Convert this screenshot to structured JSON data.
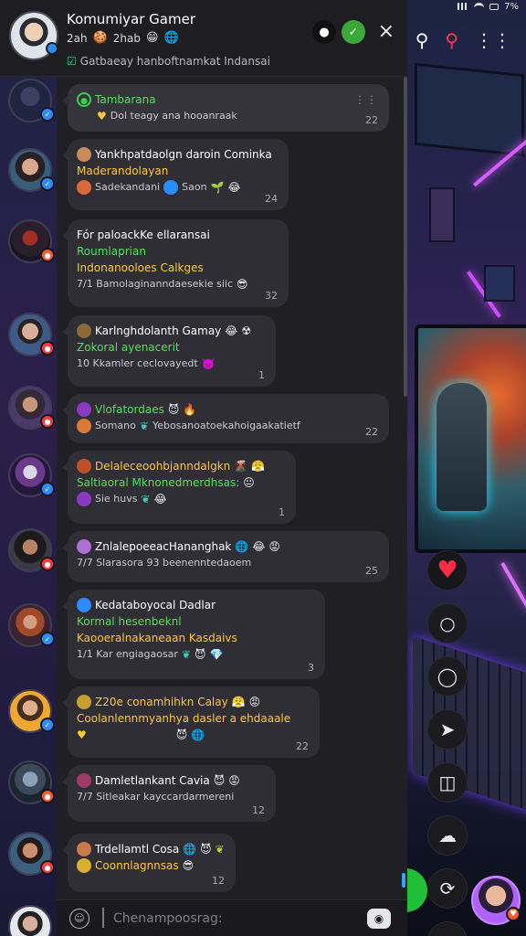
{
  "status_bar": {
    "battery": "7%"
  },
  "top_icons": [
    "search-icon",
    "search-icon",
    "more-icon"
  ],
  "header": {
    "title": "Komumiyar Gamer",
    "meta_a": "2ah",
    "meta_b": "2hab",
    "description": "Gatbaeay hanboftnamkat Indansai",
    "close": "×"
  },
  "pinned": {
    "title": "Tambarana",
    "subtitle": "Dol teagy ana hooanraak",
    "time": "22"
  },
  "messages": [
    {
      "name": "Yankhpatdaolgn daroin Cominka",
      "line1": "Maderandolayan",
      "line2": "Sadekandani",
      "line2b": "Saon",
      "time": "24"
    },
    {
      "name": "Fór paloackKe ellaransai",
      "line1": "Roumlaprian",
      "line2": "Indonanooloes Calkges",
      "line3": "7/1 Bamolaginanndaesekie siic",
      "time": "32"
    },
    {
      "name": "Karlnghdolanth Gamay",
      "line1": "Zokoral ayenacerit",
      "line2": "10 Kkamler ceclovayedt",
      "time": "1"
    },
    {
      "name": "Vlofatordaes",
      "line1": "Somano",
      "line1b": "Yebosanoatoekahoigaakatietf",
      "time": "22"
    },
    {
      "name": "Delaleceoohbjanndalgkn",
      "line1": "Saltiaoral Mknonedmerdhsas:",
      "line2": "Sie huvs",
      "time": "1"
    },
    {
      "name": "ZnlalepoeeacHananghak",
      "line1": "7/7 Slarasora  93 beenenntedaoem",
      "time": "25"
    },
    {
      "name": "Kedataboyocal Dadlar",
      "line1": "Kormal hesenbeknl",
      "line2": "Kaooeralnakaneaan Kasdaivs",
      "line3": "1/1 Kar engiagaosar",
      "time": "3"
    },
    {
      "name": "Z20e conamhihkn Calay",
      "line1": "Coolanlennmyanhya dasler a ehdaaale",
      "time": "22"
    },
    {
      "name": "Damletlankant Cavia",
      "line1": "7/7 Sitleakar kayccardarmereni",
      "time": "12"
    },
    {
      "name": "Trdellamtl Cosa",
      "line1": "Coonnlagnnsas",
      "time": "12"
    }
  ],
  "composer": {
    "placeholder": "Chenampoosrag:"
  },
  "colors": {
    "accent_green": "#53e05a",
    "accent_yellow": "#ffc83a",
    "heart": "#ff2e44"
  }
}
